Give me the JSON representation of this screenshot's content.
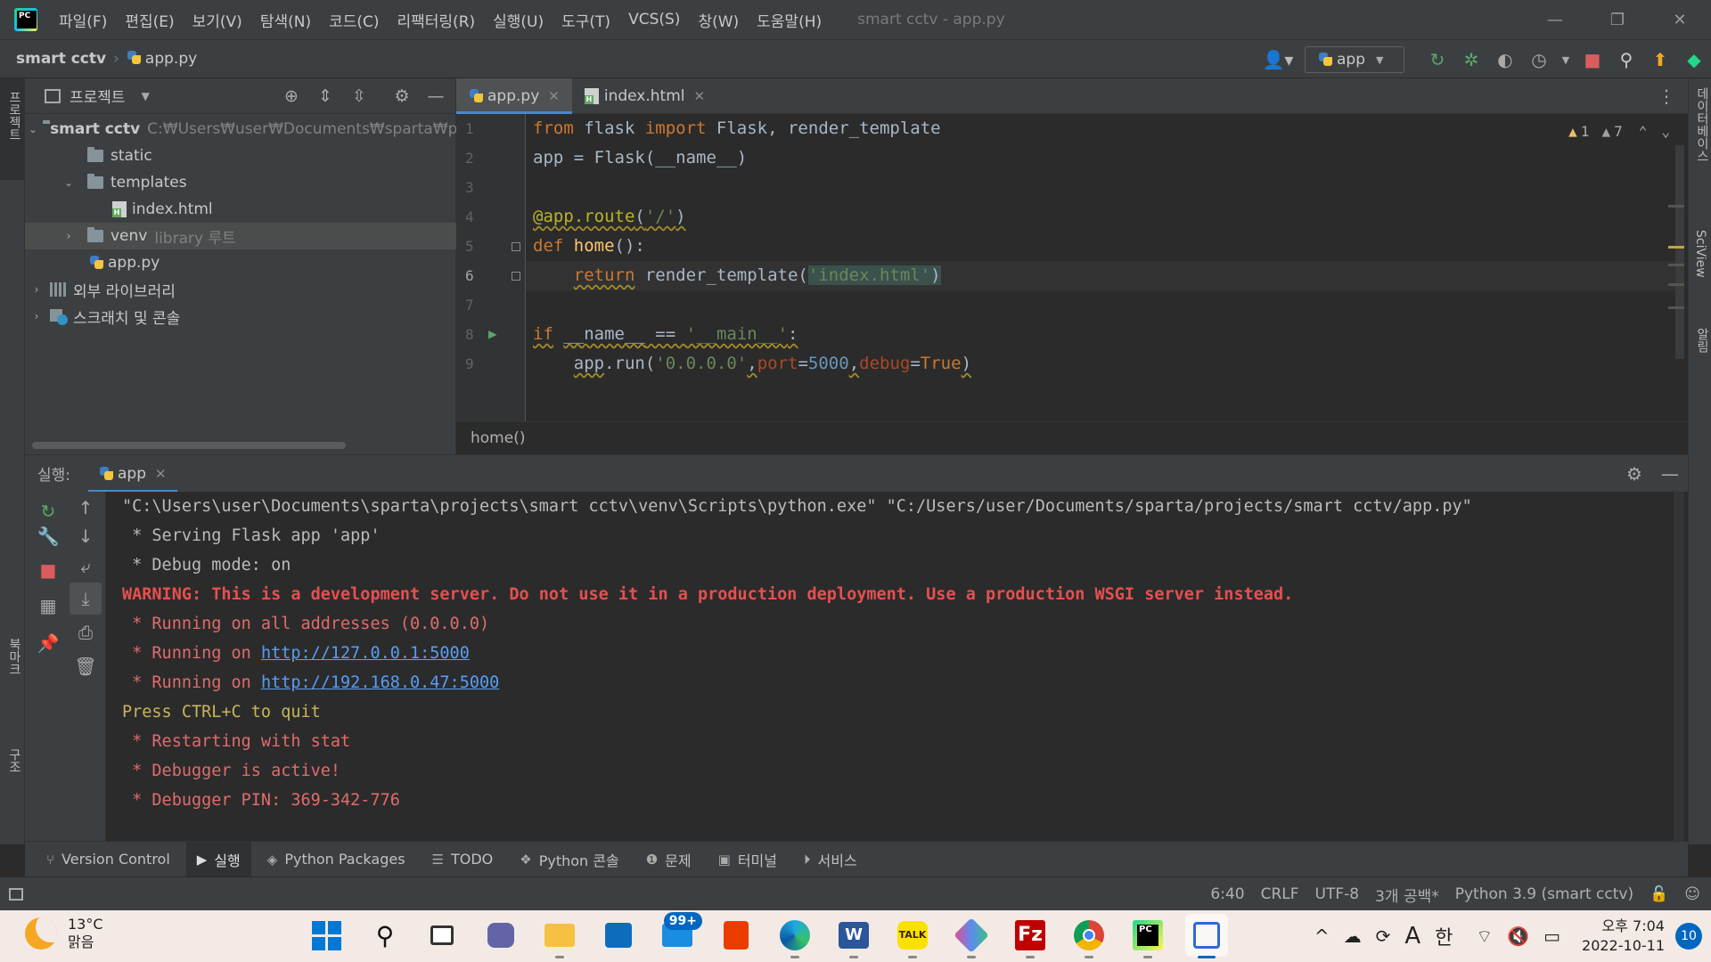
{
  "menu": [
    "파일(F)",
    "편집(E)",
    "보기(V)",
    "탐색(N)",
    "코드(C)",
    "리팩터링(R)",
    "실행(U)",
    "도구(T)",
    "VCS(S)",
    "창(W)",
    "도움말(H)"
  ],
  "window_title": "smart cctv - app.py",
  "window_controls": {
    "minimize": "—",
    "restore": "❐",
    "close": "✕"
  },
  "breadcrumb": {
    "project": "smart cctv",
    "file": "app.py"
  },
  "run_config": {
    "name": "app"
  },
  "left_stripe": {
    "project": "프로젝트",
    "bookmarks": "북마크",
    "structure": "구조"
  },
  "right_stripe": {
    "database": "데이터베이스",
    "sciview": "SciView",
    "notifications": "알림"
  },
  "project_panel": {
    "title": "프로젝트",
    "tree": {
      "root": "smart cctv",
      "root_path": "C:₩Users₩user₩Documents₩sparta₩p",
      "static": "static",
      "templates": "templates",
      "index_html": "index.html",
      "venv": "venv",
      "venv_tag": "library 루트",
      "app_py": "app.py",
      "external_libs": "외부 라이브러리",
      "scratches": "스크래치 및 콘솔"
    }
  },
  "editor": {
    "tabs": [
      {
        "label": "app.py",
        "active": true
      },
      {
        "label": "index.html",
        "active": false
      }
    ],
    "inspections": {
      "warnings": "1",
      "weak_warnings": "7"
    },
    "line_numbers": [
      "1",
      "2",
      "3",
      "4",
      "5",
      "6",
      "7",
      "8",
      "9"
    ],
    "code": {
      "l1": {
        "kw1": "from",
        "mod": " flask ",
        "kw2": "import",
        "names": " Flask, render_template"
      },
      "l2": "app = Flask(__name__)",
      "l4": {
        "deco": "@app.route",
        "open": "(",
        "str": "'/'",
        "close": ")"
      },
      "l5": {
        "kw": "def",
        "sp": " ",
        "fn": "home",
        "rest": "():"
      },
      "l6": {
        "indent": "    ",
        "kw": "return",
        "call": " render_template(",
        "str": "'index.html'",
        "close": ")"
      },
      "l8": {
        "kw": "if",
        "sp1": " ",
        "name": "__name__",
        "op": " == ",
        "str": "'__main__'",
        "colon": ":"
      },
      "l9": {
        "indent": "    ",
        "app": "app",
        "run": ".run(",
        "host": "'0.0.0.0'",
        "c1": ",",
        "port_kw": "port",
        "eq1": "=",
        "port": "5000",
        "c2": ",",
        "debug_kw": "debug",
        "eq2": "=",
        "debug": "True",
        "close": ")"
      }
    },
    "breadcrumb": "home()"
  },
  "run_panel": {
    "label": "실행:",
    "tab": "app",
    "output": {
      "cmd": "\"C:\\Users\\user\\Documents\\sparta\\projects\\smart cctv\\venv\\Scripts\\python.exe\" \"C:/Users/user/Documents/sparta/projects/smart cctv/app.py\"",
      "serving": " * Serving Flask app 'app'",
      "debug_mode": " * Debug mode: on",
      "warning": "WARNING: This is a development server. Do not use it in a production deployment. Use a production WSGI server instead.",
      "all_addresses": " * Running on all addresses (0.0.0.0)",
      "running_prefix": " * Running on ",
      "url1": "http://127.0.0.1:5000",
      "url2": "http://192.168.0.47:5000",
      "quit": "Press CTRL+C to quit",
      "restarting": " * Restarting with stat",
      "debugger_active": " * Debugger is active!",
      "debugger_pin": " * Debugger PIN: 369-342-776"
    }
  },
  "tool_tabs": [
    "Version Control",
    "실행",
    "Python Packages",
    "TODO",
    "Python 콘솔",
    "문제",
    "터미널",
    "서비스"
  ],
  "status": {
    "position": "6:40",
    "line_sep": "CRLF",
    "encoding": "UTF-8",
    "indent": "3개 공백*",
    "interpreter": "Python 3.9 (smart cctv)"
  },
  "taskbar": {
    "weather_temp": "13°C",
    "weather_desc": "맑음",
    "mail_badge": "99+",
    "ime_mode": "한",
    "ime_letter": "A",
    "time": "오후 7:04",
    "date": "2022-10-11",
    "notifications": "10"
  },
  "colors": {
    "accent": "#4a88c7",
    "warning_text": "#e84f4f",
    "link": "#589df6",
    "keyword": "#cc7832",
    "string": "#6a8759"
  }
}
